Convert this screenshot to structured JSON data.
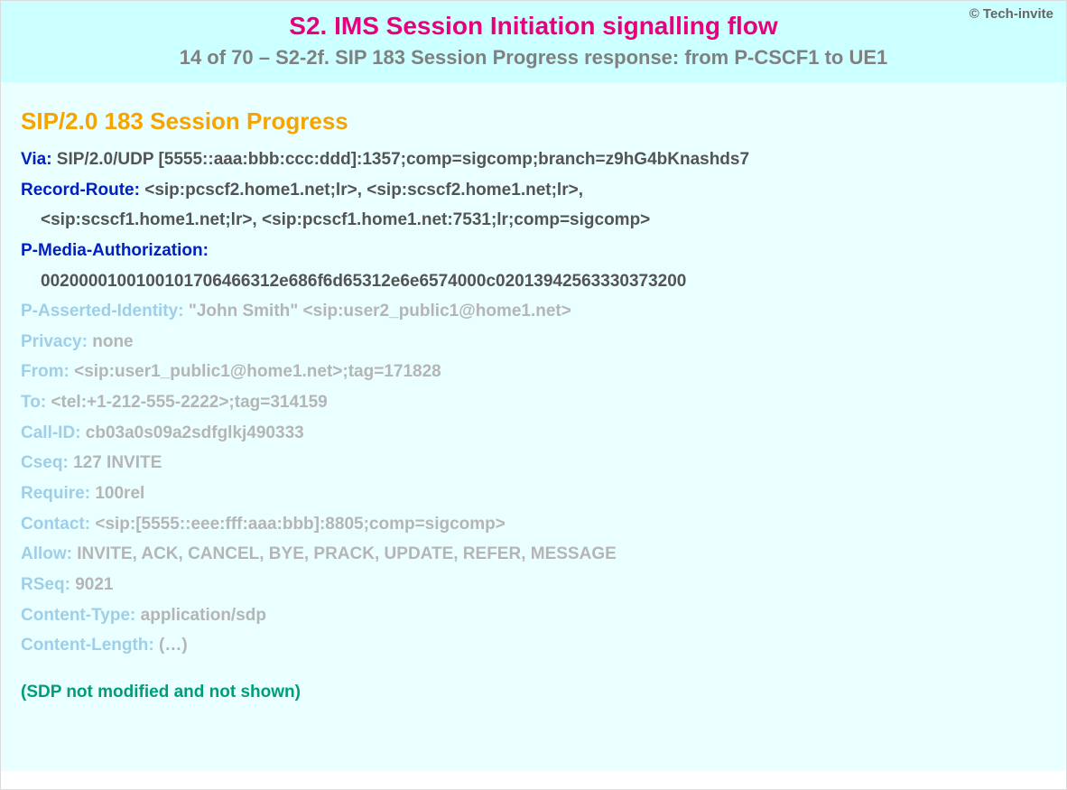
{
  "copyright": "© Tech-invite",
  "header": {
    "title": "S2. IMS Session Initiation signalling flow",
    "subtitle": "14 of 70 – S2-2f. SIP 183 Session Progress response: from P-CSCF1 to UE1"
  },
  "statusLine": "SIP/2.0 183 Session Progress",
  "primaryHeaders": [
    {
      "name": "Via",
      "value": "SIP/2.0/UDP [5555::aaa:bbb:ccc:ddd]:1357;comp=sigcomp;branch=z9hG4bKnashds7"
    }
  ],
  "recordRoute": {
    "name": "Record-Route",
    "line1": "<sip:pcscf2.home1.net;lr>, <sip:scscf2.home1.net;lr>,",
    "line2": "<sip:scscf1.home1.net;lr>, <sip:pcscf1.home1.net:7531;lr;comp=sigcomp>"
  },
  "pMediaAuth": {
    "name": "P-Media-Authorization",
    "value": "0020000100100101706466312e686f6d65312e6e6574000c02013942563330373200"
  },
  "secondaryHeaders": [
    {
      "name": "P-Asserted-Identity",
      "value": "\"John Smith\" <sip:user2_public1@home1.net>"
    },
    {
      "name": "Privacy",
      "value": "none"
    },
    {
      "name": "From",
      "value": "<sip:user1_public1@home1.net>;tag=171828"
    },
    {
      "name": "To",
      "value": "<tel:+1-212-555-2222>;tag=314159"
    },
    {
      "name": "Call-ID",
      "value": "cb03a0s09a2sdfglkj490333"
    },
    {
      "name": "Cseq",
      "value": "127 INVITE"
    },
    {
      "name": "Require",
      "value": "100rel"
    },
    {
      "name": "Contact",
      "value": "<sip:[5555::eee:fff:aaa:bbb]:8805;comp=sigcomp>"
    },
    {
      "name": "Allow",
      "value": "INVITE, ACK, CANCEL, BYE, PRACK, UPDATE, REFER, MESSAGE"
    },
    {
      "name": "RSeq",
      "value": "9021"
    },
    {
      "name": "Content-Type",
      "value": "application/sdp"
    },
    {
      "name": "Content-Length",
      "value": "(…)"
    }
  ],
  "note": "(SDP not modified and not shown)"
}
